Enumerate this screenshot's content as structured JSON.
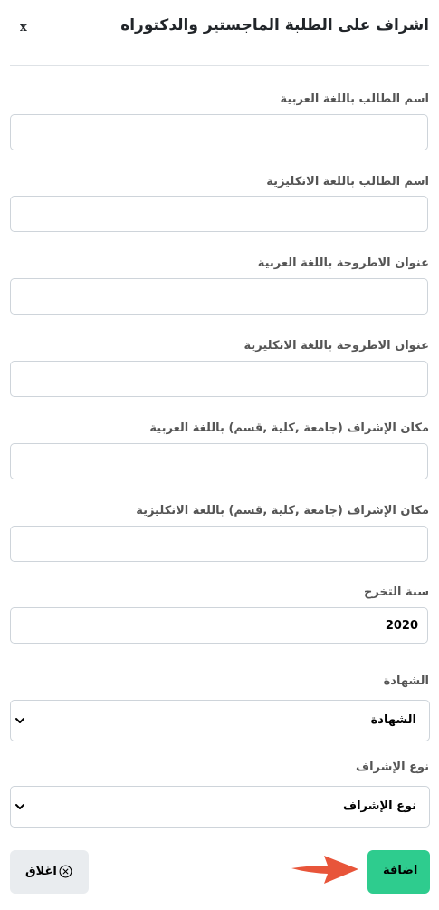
{
  "modal": {
    "title": "اشراف على الطلبة الماجستير والدكتوراه",
    "close_label": "x"
  },
  "fields": {
    "student_name_ar": {
      "label": "اسم الطالب باللغة العربية",
      "value": ""
    },
    "student_name_en": {
      "label": "اسم الطالب باللغة الانكليزية",
      "value": ""
    },
    "thesis_title_ar": {
      "label": "عنوان الاطروحة باللغة العربية",
      "value": ""
    },
    "thesis_title_en": {
      "label": "عنوان الاطروحة باللغة الانكليزية",
      "value": ""
    },
    "place_ar": {
      "label": "مكان الإشراف (جامعة ,كلية ,قسم) باللغة العربية",
      "value": ""
    },
    "place_en": {
      "label": "مكان الإشراف (جامعة ,كلية ,قسم) باللغة الانكليزية",
      "value": ""
    },
    "grad_year": {
      "label": "سنة التخرج",
      "value": "2020"
    },
    "degree": {
      "label": "الشهادة",
      "selected": "الشهادة"
    },
    "supervision_type": {
      "label": "نوع الإشراف",
      "selected": "نوع الإشراف"
    }
  },
  "actions": {
    "close_label": "اغلاق",
    "add_label": "اضافة"
  },
  "icons": {
    "close_circle": "x-circle-icon",
    "arrow": "arrow-right-icon",
    "chevron": "chevron-down-icon"
  },
  "colors": {
    "add_button": "#2ecc8e",
    "close_button": "#e9ecef",
    "arrow": "#e8553a"
  }
}
